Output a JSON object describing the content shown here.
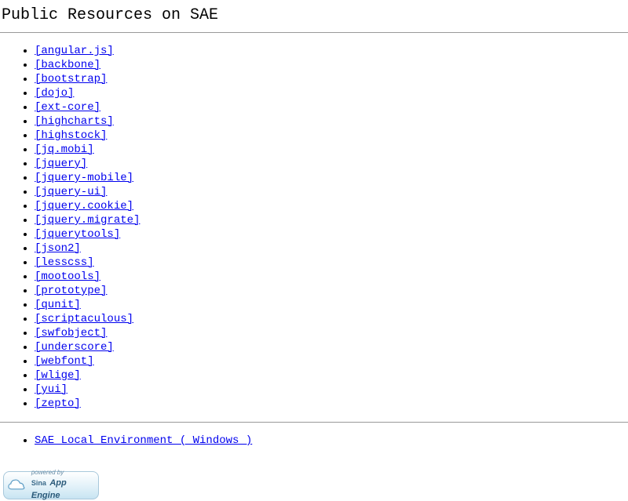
{
  "title": "Public Resources on SAE",
  "libraries": [
    "[angular.js]",
    "[backbone]",
    "[bootstrap]",
    "[dojo]",
    "[ext-core]",
    "[highcharts]",
    "[highstock]",
    "[jq.mobi]",
    "[jquery]",
    "[jquery-mobile]",
    "[jquery-ui]",
    "[jquery.cookie]",
    "[jquery.migrate]",
    "[jquerytools]",
    "[json2]",
    "[lesscss]",
    "[mootools]",
    "[prototype]",
    "[qunit]",
    "[scriptaculous]",
    "[swfobject]",
    "[underscore]",
    "[webfont]",
    "[wlige]",
    "[yui]",
    "[zepto]"
  ],
  "extra_links": [
    "SAE Local Environment ( Windows )"
  ],
  "badge": {
    "powered": "powered by",
    "brand": "Sina",
    "product": "App Engine"
  }
}
